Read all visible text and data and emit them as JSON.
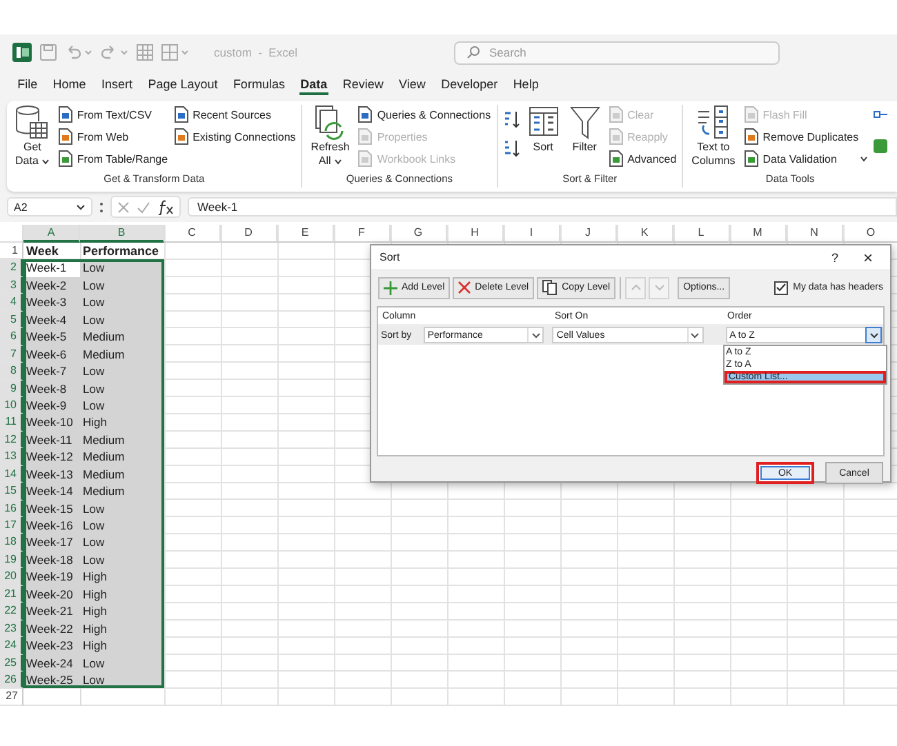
{
  "titlebar": {
    "title": "custom  -  Excel",
    "search": {
      "placeholder": "Search"
    }
  },
  "menu": [
    {
      "label": "File",
      "selected": false
    },
    {
      "label": "Home",
      "selected": false
    },
    {
      "label": "Insert",
      "selected": false
    },
    {
      "label": "Page Layout",
      "selected": false
    },
    {
      "label": "Formulas",
      "selected": false
    },
    {
      "label": "Data",
      "selected": true
    },
    {
      "label": "Review",
      "selected": false
    },
    {
      "label": "View",
      "selected": false
    },
    {
      "label": "Developer",
      "selected": false
    },
    {
      "label": "Help",
      "selected": false
    }
  ],
  "ribbon": [
    {
      "label": "Get & Transform Data",
      "columns": [
        {
          "kind": "large",
          "lines": [
            "Get",
            "Data"
          ],
          "dropdown": true
        },
        {
          "kind": "stack",
          "items": [
            {
              "label": "From Text/CSV",
              "disabled": false
            },
            {
              "label": "From Web",
              "disabled": false
            },
            {
              "label": "From Table/Range",
              "disabled": false
            }
          ]
        },
        {
          "kind": "stack",
          "items": [
            {
              "label": "Recent Sources",
              "disabled": false
            },
            {
              "label": "Existing Connections",
              "disabled": false
            }
          ]
        }
      ]
    },
    {
      "label": "Queries & Connections",
      "columns": [
        {
          "kind": "large",
          "lines": [
            "Refresh",
            "All"
          ],
          "dropdown": true
        },
        {
          "kind": "stack",
          "items": [
            {
              "label": "Queries & Connections",
              "disabled": false
            },
            {
              "label": "Properties",
              "disabled": true
            },
            {
              "label": "Workbook Links",
              "disabled": true
            }
          ]
        }
      ]
    },
    {
      "label": "Sort & Filter",
      "columns": [
        {
          "kind": "sort_icons"
        },
        {
          "kind": "large",
          "lines": [
            "Sort"
          ],
          "dropdown": false
        },
        {
          "kind": "large",
          "lines": [
            "Filter"
          ],
          "dropdown": false
        },
        {
          "kind": "stack",
          "items": [
            {
              "label": "Clear",
              "disabled": true
            },
            {
              "label": "Reapply",
              "disabled": true
            },
            {
              "label": "Advanced",
              "disabled": false
            }
          ]
        }
      ]
    },
    {
      "label": "Data Tools",
      "columns": [
        {
          "kind": "large",
          "lines": [
            "Text to",
            "Columns"
          ],
          "dropdown": false
        },
        {
          "kind": "stack",
          "items": [
            {
              "label": "Flash Fill",
              "disabled": true
            },
            {
              "label": "Remove Duplicates",
              "disabled": false
            },
            {
              "label": "Data Validation",
              "disabled": false,
              "dropdown": true
            }
          ]
        },
        {
          "kind": "icon_stack"
        }
      ]
    }
  ],
  "formula_bar": {
    "name_box": "A2",
    "formula": "Week-1"
  },
  "sheet": {
    "columns": [
      {
        "label": "A",
        "selected": true
      },
      {
        "label": "B",
        "selected": true
      },
      {
        "label": "C",
        "selected": false
      },
      {
        "label": "D",
        "selected": false
      },
      {
        "label": "E",
        "selected": false
      },
      {
        "label": "F",
        "selected": false
      },
      {
        "label": "G",
        "selected": false
      },
      {
        "label": "H",
        "selected": false
      },
      {
        "label": "I",
        "selected": false
      },
      {
        "label": "J",
        "selected": false
      },
      {
        "label": "K",
        "selected": false
      },
      {
        "label": "L",
        "selected": false
      },
      {
        "label": "M",
        "selected": false
      },
      {
        "label": "N",
        "selected": false
      },
      {
        "label": "O",
        "selected": false
      }
    ],
    "rows": [
      {
        "row": "1",
        "kind": "header",
        "cells": [
          "Week",
          "Performance"
        ],
        "selected": false
      },
      {
        "row": "2",
        "kind": "data",
        "cells": [
          "Week-1",
          "Low"
        ],
        "selected": true,
        "active": true
      },
      {
        "row": "3",
        "kind": "data",
        "cells": [
          "Week-2",
          "Low"
        ],
        "selected": true
      },
      {
        "row": "4",
        "kind": "data",
        "cells": [
          "Week-3",
          "Low"
        ],
        "selected": true
      },
      {
        "row": "5",
        "kind": "data",
        "cells": [
          "Week-4",
          "Low"
        ],
        "selected": true
      },
      {
        "row": "6",
        "kind": "data",
        "cells": [
          "Week-5",
          "Medium"
        ],
        "selected": true
      },
      {
        "row": "7",
        "kind": "data",
        "cells": [
          "Week-6",
          "Medium"
        ],
        "selected": true
      },
      {
        "row": "8",
        "kind": "data",
        "cells": [
          "Week-7",
          "Low"
        ],
        "selected": true
      },
      {
        "row": "9",
        "kind": "data",
        "cells": [
          "Week-8",
          "Low"
        ],
        "selected": true
      },
      {
        "row": "10",
        "kind": "data",
        "cells": [
          "Week-9",
          "Low"
        ],
        "selected": true
      },
      {
        "row": "11",
        "kind": "data",
        "cells": [
          "Week-10",
          "High"
        ],
        "selected": true
      },
      {
        "row": "12",
        "kind": "data",
        "cells": [
          "Week-11",
          "Medium"
        ],
        "selected": true
      },
      {
        "row": "13",
        "kind": "data",
        "cells": [
          "Week-12",
          "Medium"
        ],
        "selected": true
      },
      {
        "row": "14",
        "kind": "data",
        "cells": [
          "Week-13",
          "Medium"
        ],
        "selected": true
      },
      {
        "row": "15",
        "kind": "data",
        "cells": [
          "Week-14",
          "Medium"
        ],
        "selected": true
      },
      {
        "row": "16",
        "kind": "data",
        "cells": [
          "Week-15",
          "Low"
        ],
        "selected": true
      },
      {
        "row": "17",
        "kind": "data",
        "cells": [
          "Week-16",
          "Low"
        ],
        "selected": true
      },
      {
        "row": "18",
        "kind": "data",
        "cells": [
          "Week-17",
          "Low"
        ],
        "selected": true
      },
      {
        "row": "19",
        "kind": "data",
        "cells": [
          "Week-18",
          "Low"
        ],
        "selected": true
      },
      {
        "row": "20",
        "kind": "data",
        "cells": [
          "Week-19",
          "High"
        ],
        "selected": true
      },
      {
        "row": "21",
        "kind": "data",
        "cells": [
          "Week-20",
          "High"
        ],
        "selected": true
      },
      {
        "row": "22",
        "kind": "data",
        "cells": [
          "Week-21",
          "High"
        ],
        "selected": true
      },
      {
        "row": "23",
        "kind": "data",
        "cells": [
          "Week-22",
          "High"
        ],
        "selected": true
      },
      {
        "row": "24",
        "kind": "data",
        "cells": [
          "Week-23",
          "High"
        ],
        "selected": true
      },
      {
        "row": "25",
        "kind": "data",
        "cells": [
          "Week-24",
          "Low"
        ],
        "selected": true
      },
      {
        "row": "26",
        "kind": "data",
        "cells": [
          "Week-25",
          "Low"
        ],
        "selected": true
      },
      {
        "row": "27",
        "kind": "empty",
        "selected": false
      }
    ]
  },
  "sort_dialog": {
    "title": "Sort",
    "help": "?",
    "close": "×",
    "toolbar": [
      {
        "kind": "add",
        "label": "Add Level",
        "disabled": false
      },
      {
        "kind": "delete",
        "label": "Delete Level",
        "disabled": false
      },
      {
        "kind": "copy",
        "label": "Copy Level",
        "disabled": false
      },
      {
        "kind": "up",
        "disabled": true
      },
      {
        "kind": "down",
        "disabled": true
      },
      {
        "kind": "text",
        "label": "Options...",
        "disabled": false
      }
    ],
    "headers_checkbox": {
      "label": "My data has headers",
      "checked": true
    },
    "columns": [
      "Column",
      "Sort On",
      "Order"
    ],
    "level": {
      "label": "Sort by",
      "column": "Performance",
      "sort_on": "Cell Values",
      "order": "A to Z"
    },
    "order_options": [
      {
        "label": "A to Z",
        "selected": false,
        "highlighted": false
      },
      {
        "label": "Z to A",
        "selected": false,
        "highlighted": false
      },
      {
        "label": "Custom List...",
        "selected": true,
        "highlighted": true
      }
    ],
    "buttons": [
      {
        "kind": "primary",
        "label": "OK",
        "highlighted": true
      },
      {
        "kind": "secondary",
        "label": "Cancel",
        "highlighted": false
      }
    ]
  }
}
